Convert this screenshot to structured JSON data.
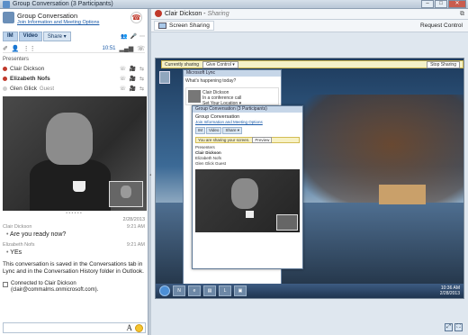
{
  "window": {
    "title": "Group Conversation (3 Participants)"
  },
  "conversation": {
    "title": "Group Conversation",
    "info_link": "Join Information and Meeting Options"
  },
  "tabs": [
    {
      "label": "IM"
    },
    {
      "label": "Video"
    },
    {
      "label": "Share ▾"
    }
  ],
  "call": {
    "timer": "10:51"
  },
  "presenters": {
    "label": "Presenters",
    "people": [
      {
        "name": "Clair Dickson",
        "status_color": "#c0392b",
        "role": ""
      },
      {
        "name": "Elizabeth Nofs",
        "status_color": "#c0392b",
        "role": ""
      },
      {
        "name": "Glen Glick",
        "status_color": "#cfcfcf",
        "role": "Guest"
      }
    ]
  },
  "im": {
    "date": "2/28/2013",
    "messages": [
      {
        "sender": "Clair Dickson",
        "time": "9:21 AM",
        "text": "Are you ready now?"
      },
      {
        "sender": "Elizabeth Nofs",
        "time": "9:21 AM",
        "text": "YEs"
      }
    ],
    "system_note": "This conversation is saved in the Conversations tab in Lync and in the Conversation History folder in Outlook.",
    "connected": "Connected to Clair Dickson (clair@commalms.onmicrosoft.com)."
  },
  "compose": {
    "placeholder": ""
  },
  "sharing_pane": {
    "presenter": "Clair Dickson",
    "status": "Sharing",
    "title_sep": " - ",
    "pop_out": "⧉",
    "view_button": "Screen Sharing",
    "request_control": "Request Control"
  },
  "shared_desktop": {
    "share_bar_status": "Currently sharing",
    "give_control": "Give Control ▾",
    "stop_sharing": "Stop Sharing",
    "lync_title": "Microsoft Lync",
    "lync_status": "What's happening today?",
    "lync_person": "Clair Dickson",
    "lync_person_status": "In a conference call",
    "lync_location": "Set Your Location ▾",
    "nested_title": "Group Conversation (3 Participants)",
    "nested_conv_title": "Group Conversation",
    "nested_link": "Join Information and Meeting Options",
    "nested_tabs": [
      "IM",
      "Video",
      "Share ▾"
    ],
    "nested_banner": "You are sharing your screen.",
    "nested_preview": "Preview",
    "nested_presenters": "Presenters",
    "nested_people": [
      "Clair Dickson",
      "Elizabeth Nofs",
      "Glen Glick  Guest"
    ],
    "clock_time": "10:36 AM",
    "clock_date": "2/28/2013",
    "recycle_label": "Recycle Bin"
  },
  "colors": {
    "accent": "#1a5aa8",
    "status_busy": "#c0392b"
  }
}
